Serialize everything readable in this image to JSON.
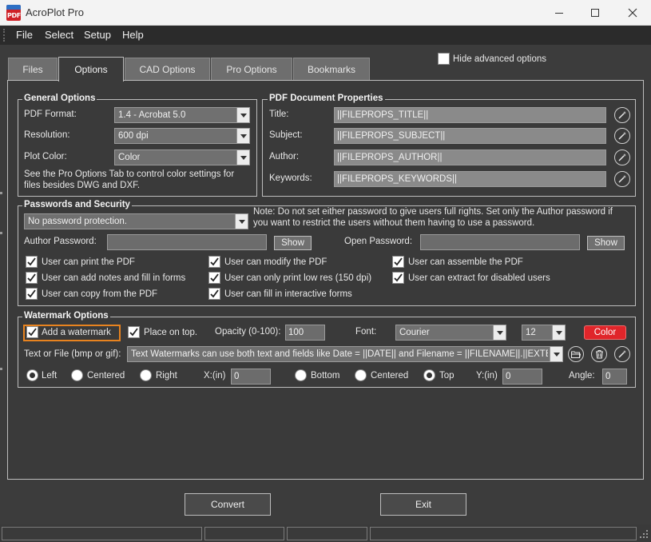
{
  "window": {
    "title": "AcroPlot Pro",
    "icon_label": "PDF"
  },
  "menu": [
    "File",
    "Select",
    "Setup",
    "Help"
  ],
  "tabs": [
    "Files",
    "Options",
    "CAD Options",
    "Pro Options",
    "Bookmarks"
  ],
  "active_tab": "Options",
  "hide_advanced": {
    "label": "Hide advanced options",
    "checked": false
  },
  "general": {
    "title": "General Options",
    "pdf_format_label": "PDF Format:",
    "pdf_format_value": "1.4 - Acrobat 5.0",
    "resolution_label": "Resolution:",
    "resolution_value": "600 dpi",
    "plot_color_label": "Plot Color:",
    "plot_color_value": "Color",
    "note_line1": "See the Pro Options Tab to control color settings for",
    "note_line2": "files besides DWG and DXF."
  },
  "doc_props": {
    "title": "PDF Document Properties",
    "title_label": "Title:",
    "title_value": "||FILEPROPS_TITLE||",
    "subject_label": "Subject:",
    "subject_value": "||FILEPROPS_SUBJECT||",
    "author_label": "Author:",
    "author_value": "||FILEPROPS_AUTHOR||",
    "keywords_label": "Keywords:",
    "keywords_value": "||FILEPROPS_KEYWORDS||"
  },
  "security": {
    "title": "Passwords and Security",
    "protection_value": "No password protection.",
    "note_line1": "Note:  Do not set either password to give users full rights.  Set only the Author password if",
    "note_line2": "you want to restrict the users without them having to use a password.",
    "author_password_label": "Author Password:",
    "open_password_label": "Open Password:",
    "show_label": "Show",
    "permissions": [
      {
        "label": "User can print the PDF",
        "checked": true
      },
      {
        "label": "User can modify the PDF",
        "checked": true
      },
      {
        "label": "User can assemble the PDF",
        "checked": true
      },
      {
        "label": "User can add notes and fill in forms",
        "checked": true
      },
      {
        "label": "User can only print low res (150 dpi)",
        "checked": true
      },
      {
        "label": "User can extract for disabled users",
        "checked": true
      },
      {
        "label": "User can copy from the PDF",
        "checked": true
      },
      {
        "label": "User can fill in interactive forms",
        "checked": true
      }
    ]
  },
  "watermark": {
    "title": "Watermark Options",
    "add_label": "Add a watermark",
    "add_checked": true,
    "place_top_label": "Place on top.",
    "place_top_checked": true,
    "opacity_label": "Opacity (0-100):",
    "opacity_value": "100",
    "font_label": "Font:",
    "font_value": "Courier",
    "font_size_value": "12",
    "color_label": "Color",
    "color_hex": "#e0252a",
    "text_label": "Text or File (bmp or gif):",
    "text_value": "Text Watermarks can use both text and fields like Date = ||DATE|| and Filename = ||FILENAME||.||EXTENSION||",
    "h_align": [
      "Left",
      "Centered",
      "Right"
    ],
    "h_selected": "Left",
    "x_label": "X:(in)",
    "x_value": "0",
    "v_align": [
      "Bottom",
      "Centered",
      "Top"
    ],
    "v_selected": "Top",
    "y_label": "Y:(in)",
    "y_value": "0",
    "angle_label": "Angle:",
    "angle_value": "0"
  },
  "buttons": {
    "convert": "Convert",
    "exit": "Exit"
  },
  "icons": {
    "title_icon": "acroplot-pdf-icon",
    "wand": "magic-wand-icon",
    "folder": "folder-open-icon",
    "trash": "trash-icon"
  }
}
